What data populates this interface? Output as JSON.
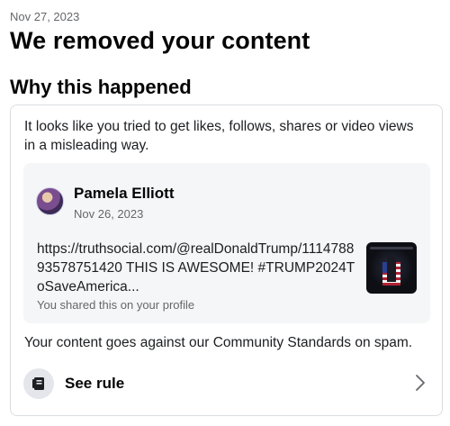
{
  "notice": {
    "date": "Nov 27, 2023",
    "title": "We removed your content",
    "subtitle": "Why this happened"
  },
  "card": {
    "reason": "It looks like you tried to get likes, follows, shares or video views in a misleading way.",
    "post": {
      "author": "Pamela Elliott",
      "date": "Nov 26, 2023",
      "text": "https://truthsocial.com/@realDonaldTrump/111478893578751420 THIS IS AWESOME! #TRUMP2024ToSaveAmerica...",
      "note": "You shared this on your profile",
      "avatar_icon": "user-avatar",
      "thumbnail_icon": "video-thumbnail"
    },
    "standards": "Your content goes against our Community Standards on spam.",
    "rule_button": {
      "label": "See rule",
      "icon": "rulebook-icon",
      "chevron_icon": "chevron-right-icon"
    }
  },
  "colors": {
    "text": "#050505",
    "secondary": "#65676b",
    "card_border": "#dadde1",
    "post_bg": "#f5f6f7",
    "icon_bg": "#e4e6eb"
  }
}
